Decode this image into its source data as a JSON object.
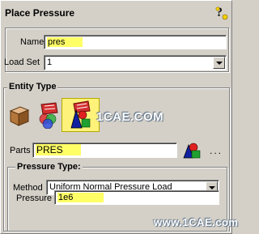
{
  "panel": {
    "title": "Place Pressure",
    "help_icon": "help-question-icon"
  },
  "fields": {
    "name_label": "Name",
    "name_value": "pres",
    "load_set_label": "Load Set",
    "load_set_value": "1"
  },
  "entity_type": {
    "title": "Entity Type",
    "tools": [
      {
        "icon": "element-box-icon",
        "selected": false
      },
      {
        "icon": "element-faces-icon",
        "selected": false
      },
      {
        "icon": "part-shapes-icon",
        "selected": true
      }
    ],
    "parts_label": "Parts",
    "parts_value": "PRES",
    "part_picker_icon": "part-picker-icon",
    "more_label": "...",
    "watermark": "1CAE.COM"
  },
  "pressure_type": {
    "title": "Pressure Type:",
    "method_label": "Method",
    "method_value": "Uniform Normal Pressure Load",
    "pressure_label": "Pressure",
    "pressure_value": "1e6",
    "watermark": "www.1CAE.com"
  },
  "colors": {
    "highlight": "#ffff66",
    "dialog_bg": "#d4d0c8"
  }
}
